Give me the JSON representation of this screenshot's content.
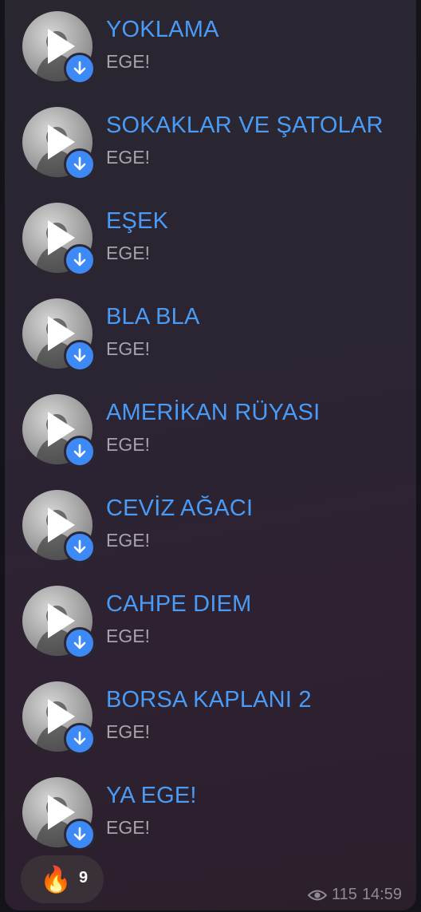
{
  "tracks": [
    {
      "title": "YOKLAMA",
      "artist": "EGE!"
    },
    {
      "title": "SOKAKLAR VE ŞATOLAR",
      "artist": "EGE!"
    },
    {
      "title": "EŞEK",
      "artist": "EGE!"
    },
    {
      "title": "BLA BLA",
      "artist": "EGE!"
    },
    {
      "title": "AMERİKAN RÜYASI",
      "artist": "EGE!"
    },
    {
      "title": "CEVİZ AĞACI",
      "artist": "EGE!"
    },
    {
      "title": "CAHPE DIEM",
      "artist": "EGE!"
    },
    {
      "title": "BORSA KAPLANI 2",
      "artist": "EGE!"
    },
    {
      "title": "YA EGE!",
      "artist": "EGE!"
    }
  ],
  "reaction": {
    "emoji": "🔥",
    "count": "9"
  },
  "footer": {
    "views": "115",
    "time": "14:59",
    "views_icon": "eye-icon"
  },
  "colors": {
    "title": "#4a9bf5",
    "artist": "#a6a3aa",
    "download": "#3d8af7"
  }
}
